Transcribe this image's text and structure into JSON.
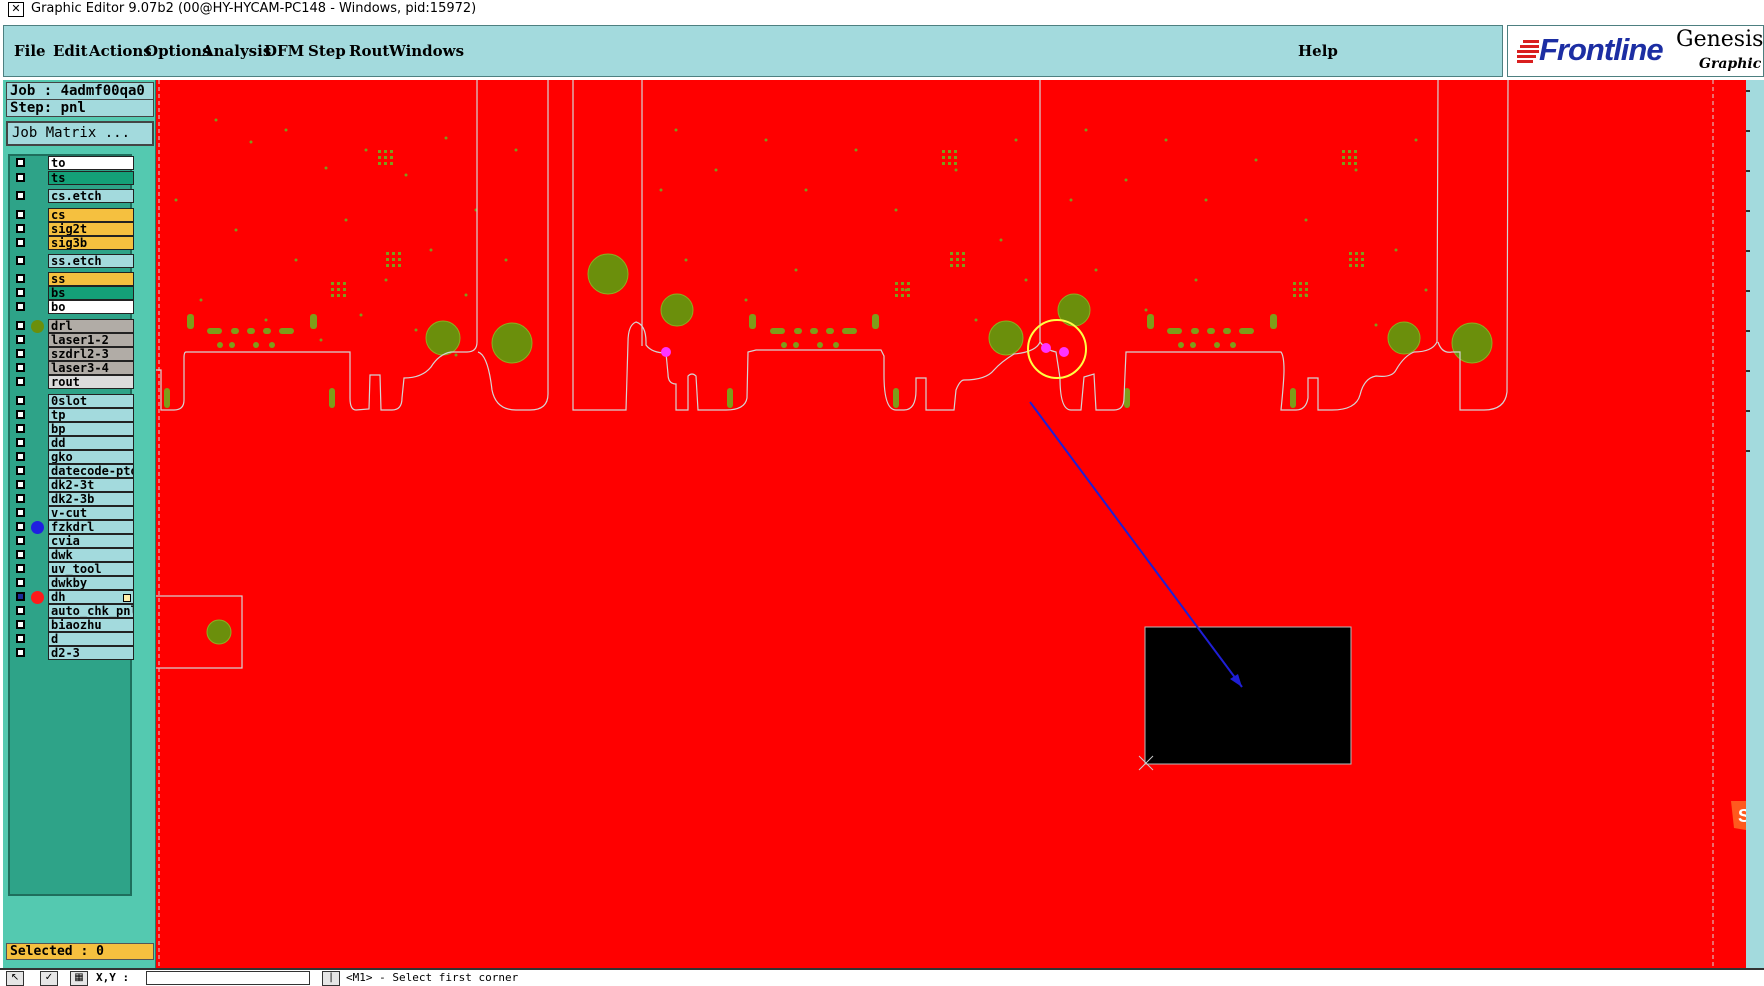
{
  "window": {
    "title": "Graphic Editor 9.07b2 (00@HY-HYCAM-PC148 - Windows, pid:15972)"
  },
  "menu": {
    "items": [
      "File",
      "Edit",
      "Actions",
      "Options",
      "Analysis",
      "DFM",
      "Step",
      "Rout",
      "Windows"
    ],
    "help": "Help"
  },
  "logo": {
    "brand": "Frontline",
    "product": "Genesis",
    "subtitle": "Graphic Ed"
  },
  "job": {
    "line": "Job : 4admf00qa0",
    "step_line": "Step: pnl",
    "matrix_button": "Job Matrix ..."
  },
  "layers": [
    {
      "name": "to",
      "color": "#ffffff"
    },
    {
      "name": "ts",
      "color": "#14a078"
    },
    {
      "name": "cs.etch",
      "color": "#a3dadd"
    },
    {
      "name": "cs",
      "color": "#f5c03f"
    },
    {
      "name": "sig2t",
      "color": "#f5c03f"
    },
    {
      "name": "sig3b",
      "color": "#f5c03f"
    },
    {
      "name": "ss.etch",
      "color": "#a3dadd"
    },
    {
      "name": "ss",
      "color": "#f5c03f"
    },
    {
      "name": "bs",
      "color": "#14a078"
    },
    {
      "name": "bo",
      "color": "#ffffff"
    },
    {
      "name": "drl",
      "color": "#b1aca6",
      "dot": "#6b8f0c"
    },
    {
      "name": "laser1-2",
      "color": "#b1aca6"
    },
    {
      "name": "szdrl2-3",
      "color": "#b1aca6"
    },
    {
      "name": "laser3-4",
      "color": "#b1aca6"
    },
    {
      "name": "rout",
      "color": "#dcdcdc"
    },
    {
      "name": "0slot",
      "color": "#a3dadd"
    },
    {
      "name": "tp",
      "color": "#a3dadd"
    },
    {
      "name": "bp",
      "color": "#a3dadd"
    },
    {
      "name": "dd",
      "color": "#a3dadd"
    },
    {
      "name": "gko",
      "color": "#a3dadd"
    },
    {
      "name": "datecode-pto",
      "color": "#a3dadd"
    },
    {
      "name": "dk2-3t",
      "color": "#a3dadd"
    },
    {
      "name": "dk2-3b",
      "color": "#a3dadd"
    },
    {
      "name": "v-cut",
      "color": "#a3dadd"
    },
    {
      "name": "fzkdrl",
      "color": "#a3dadd",
      "dot": "#1f1fe0"
    },
    {
      "name": "cvia",
      "color": "#a3dadd"
    },
    {
      "name": "dwk",
      "color": "#a3dadd"
    },
    {
      "name": "uv_tool",
      "color": "#a3dadd"
    },
    {
      "name": "dwkby",
      "color": "#a3dadd"
    },
    {
      "name": "dh",
      "color": "#a3dadd",
      "dot": "#ff1a1a",
      "checked": true,
      "mark": true
    },
    {
      "name": "auto_chk_pnl",
      "color": "#a3dadd"
    },
    {
      "name": "biaozhu",
      "color": "#a3dadd"
    },
    {
      "name": "d",
      "color": "#a3dadd"
    },
    {
      "name": "d2-3",
      "color": "#a3dadd"
    }
  ],
  "selected": "Selected : 0",
  "statusbar": {
    "xy_label": "X,Y :",
    "message": "<M1> - Select first corner"
  },
  "colors": {
    "board": "#ff0000",
    "pad": "#6b8f0c",
    "panel_bg": "#a3dadd",
    "sidebar_bg": "#54c9b0",
    "highlight": "#ffff00",
    "arrow": "#1f1fd6",
    "magenta": "#ff00ff"
  }
}
